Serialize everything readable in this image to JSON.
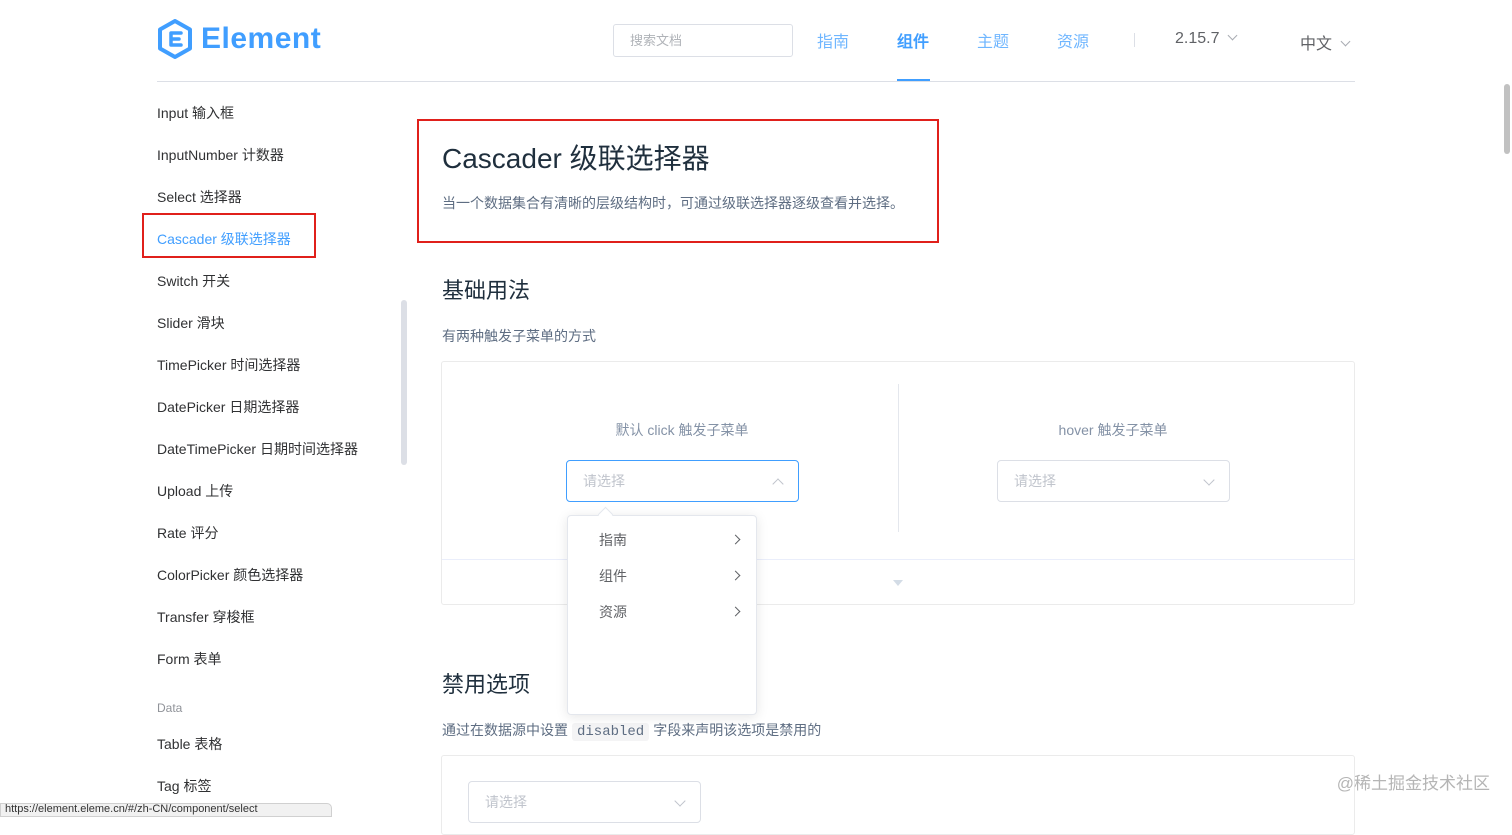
{
  "header": {
    "logo_text": "Element",
    "search_placeholder": "搜索文档",
    "nav": [
      "指南",
      "组件",
      "主题",
      "资源"
    ],
    "version": "2.15.7",
    "language": "中文",
    "accent_color": "#409eff"
  },
  "sidebar": {
    "items_top": [
      "Input 输入框",
      "InputNumber 计数器",
      "Select 选择器",
      "Cascader 级联选择器",
      "Switch 开关",
      "Slider 滑块",
      "TimePicker 时间选择器",
      "DatePicker 日期选择器",
      "DateTimePicker 日期时间选择器",
      "Upload 上传",
      "Rate 评分",
      "ColorPicker 颜色选择器",
      "Transfer 穿梭框",
      "Form 表单"
    ],
    "group_data": "Data",
    "items_data": [
      "Table 表格",
      "Tag 标签"
    ],
    "active_item": "Cascader 级联选择器"
  },
  "main": {
    "title": "Cascader 级联选择器",
    "description": "当一个数据集合有清晰的层级结构时，可通过级联选择器逐级查看并选择。",
    "section_basic": {
      "heading": "基础用法",
      "text": "有两种触发子菜单的方式",
      "demo_left_label": "默认 click 触发子菜单",
      "demo_right_label": "hover 触发子菜单",
      "placeholder": "请选择",
      "dropdown_options": [
        "指南",
        "组件",
        "资源"
      ]
    },
    "section_disabled": {
      "heading": "禁用选项",
      "text_before": "通过在数据源中设置",
      "code": "disabled",
      "text_after": "字段来声明该选项是禁用的",
      "placeholder": "请选择"
    }
  },
  "watermark": "@稀土掘金技术社区",
  "status_url": "https://element.eleme.cn/#/zh-CN/component/select"
}
